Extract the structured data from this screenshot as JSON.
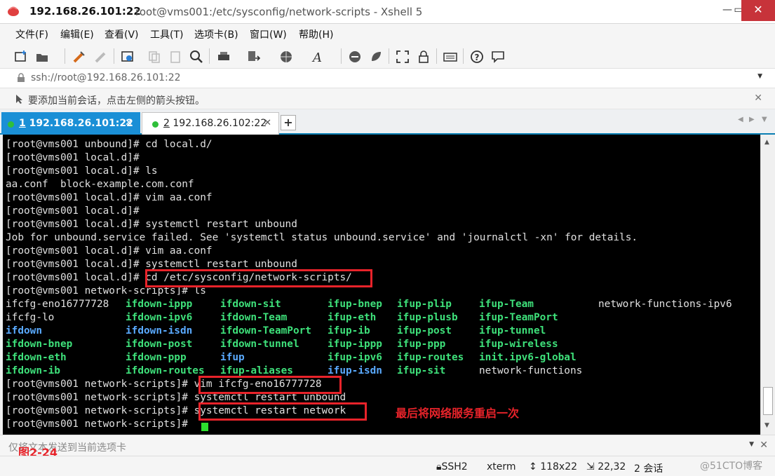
{
  "window": {
    "title_host": "192.168.26.101:22",
    "title_rest": "root@vms001:/etc/sysconfig/network-scripts - Xshell 5",
    "min_glyph": "—",
    "max_glyph": "▭",
    "close_glyph": "✕"
  },
  "menu": [
    "文件(F)",
    "编辑(E)",
    "查看(V)",
    "工具(T)",
    "选项卡(B)",
    "窗口(W)",
    "帮助(H)"
  ],
  "toolbar_icons": [
    "new-session-icon",
    "open-folder-icon",
    "reconnect-icon",
    "disconnect-icon",
    "properties-icon",
    "copy-icon",
    "paste-icon",
    "find-icon",
    "print-icon",
    "transfer-icon",
    "globe-icon",
    "font-icon",
    "xftp-icon",
    "xmanager-icon",
    "fullscreen-icon",
    "lock-icon",
    "keyboard-icon",
    "help-icon",
    "chat-icon"
  ],
  "address": {
    "value": "ssh://root@192.168.26.101:22"
  },
  "info": {
    "text": "要添加当前会话，点击左侧的箭头按钮。",
    "close_glyph": "✕"
  },
  "tabs": [
    {
      "num": "1",
      "host": "192.168.26.101:22",
      "active": true
    },
    {
      "num": "2",
      "host": "192.168.26.102:22",
      "active": false
    }
  ],
  "tab_close_glyph": "✕",
  "tab_add_glyph": "+",
  "terminal": {
    "lines_top": [
      "[root@vms001 unbound]# cd local.d/",
      "[root@vms001 local.d]#",
      "[root@vms001 local.d]# ls",
      "aa.conf  block-example.com.conf",
      "[root@vms001 local.d]# vim aa.conf",
      "[root@vms001 local.d]#",
      "[root@vms001 local.d]# systemctl restart unbound",
      "Job for unbound.service failed. See 'systemctl status unbound.service' and 'journalctl -xn' for details.",
      "[root@vms001 local.d]# vim aa.conf",
      "[root@vms001 local.d]# systemctl restart unbound",
      "[root@vms001 local.d]# cd /etc/sysconfig/network-scripts/",
      "[root@vms001 network-scripts]# ls"
    ],
    "ls_rows": [
      [
        [
          "ifcfg-eno16777728",
          "plain"
        ],
        [
          "ifdown-ippp",
          "exec"
        ],
        [
          "ifdown-sit",
          "exec"
        ],
        [
          "ifup-bnep",
          "exec"
        ],
        [
          "ifup-plip",
          "exec"
        ],
        [
          "ifup-Team",
          "exec"
        ],
        [
          "network-functions-ipv6",
          "plain"
        ]
      ],
      [
        [
          "ifcfg-lo",
          "plain"
        ],
        [
          "ifdown-ipv6",
          "exec"
        ],
        [
          "ifdown-Team",
          "exec"
        ],
        [
          "ifup-eth",
          "exec"
        ],
        [
          "ifup-plusb",
          "exec"
        ],
        [
          "ifup-TeamPort",
          "exec"
        ],
        [
          "",
          ""
        ]
      ],
      [
        [
          "ifdown",
          "dir"
        ],
        [
          "ifdown-isdn",
          "dir"
        ],
        [
          "ifdown-TeamPort",
          "exec"
        ],
        [
          "ifup-ib",
          "exec"
        ],
        [
          "ifup-post",
          "exec"
        ],
        [
          "ifup-tunnel",
          "exec"
        ],
        [
          "",
          ""
        ]
      ],
      [
        [
          "ifdown-bnep",
          "exec"
        ],
        [
          "ifdown-post",
          "exec"
        ],
        [
          "ifdown-tunnel",
          "exec"
        ],
        [
          "ifup-ippp",
          "exec"
        ],
        [
          "ifup-ppp",
          "exec"
        ],
        [
          "ifup-wireless",
          "exec"
        ],
        [
          "",
          ""
        ]
      ],
      [
        [
          "ifdown-eth",
          "exec"
        ],
        [
          "ifdown-ppp",
          "exec"
        ],
        [
          "ifup",
          "dir"
        ],
        [
          "ifup-ipv6",
          "exec"
        ],
        [
          "ifup-routes",
          "exec"
        ],
        [
          "init.ipv6-global",
          "exec"
        ],
        [
          "",
          ""
        ]
      ],
      [
        [
          "ifdown-ib",
          "exec"
        ],
        [
          "ifdown-routes",
          "exec"
        ],
        [
          "ifup-aliases",
          "exec"
        ],
        [
          "ifup-isdn",
          "dir"
        ],
        [
          "ifup-sit",
          "exec"
        ],
        [
          "network-functions",
          "plain"
        ],
        [
          "",
          ""
        ]
      ]
    ],
    "lines_bottom": [
      "[root@vms001 network-scripts]# vim ifcfg-eno16777728",
      "[root@vms001 network-scripts]# systemctl restart unbound",
      "[root@vms001 network-scripts]# systemctl restart network",
      "[root@vms001 network-scripts]# "
    ],
    "annotation": "最后将网络服务重启一次"
  },
  "sendbar": {
    "placeholder": "仅将文本发送到当前选项卡",
    "close_glyph": "✕"
  },
  "figure_label": "图2-24",
  "status": {
    "protocol": "SSH2",
    "term": "xterm",
    "size": "118x22",
    "pos": "22,32",
    "sessions": "2 会话"
  },
  "watermark": "@51CTO博客",
  "colors": {
    "accent": "#1a8fd6",
    "highlight": "#e8232a",
    "exec": "#3ee07a",
    "dir": "#5aaaff"
  }
}
